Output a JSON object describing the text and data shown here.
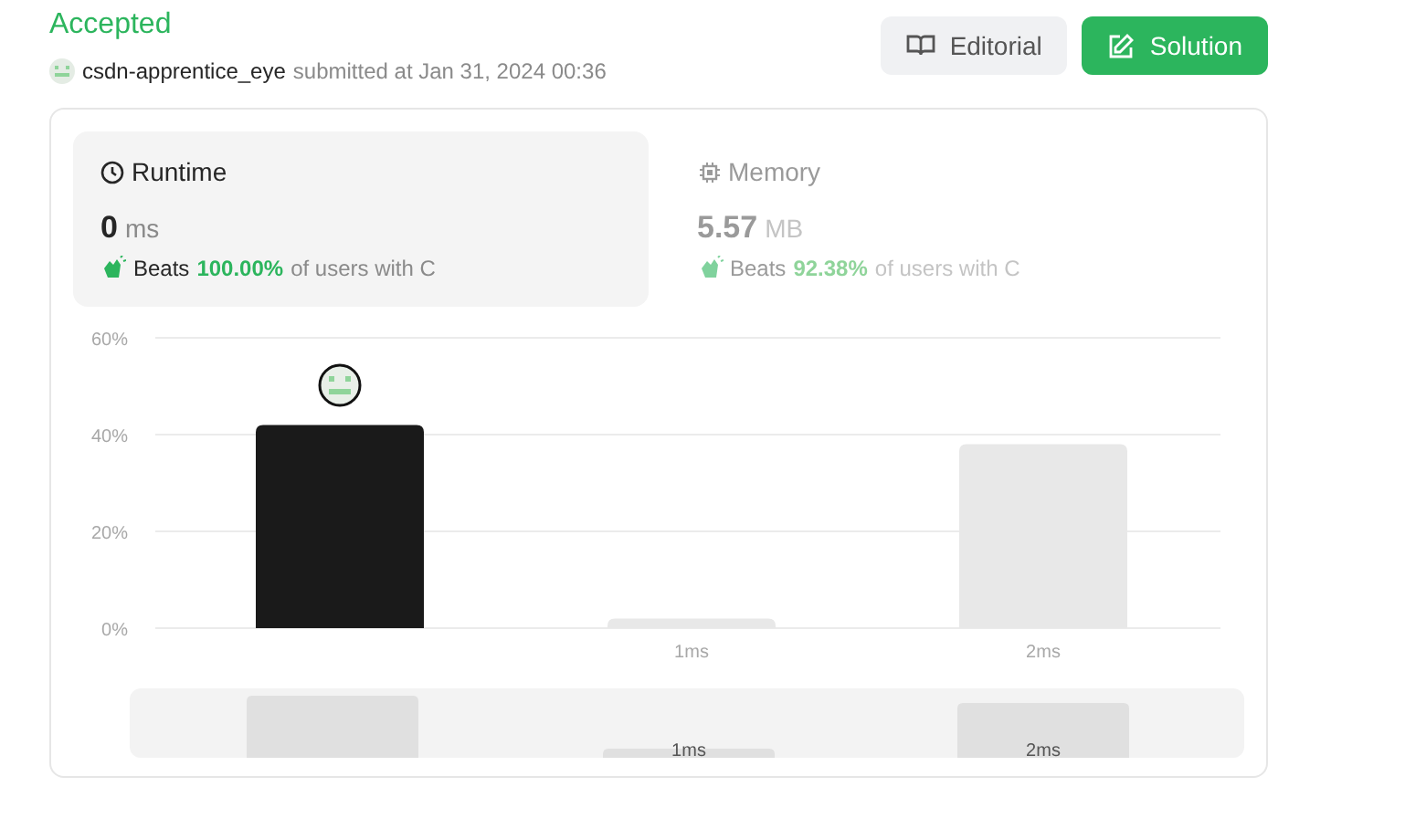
{
  "status": "Accepted",
  "submission": {
    "user": "csdn-apprentice_eye",
    "submitted": "submitted at Jan 31, 2024 00:36"
  },
  "buttons": [
    {
      "kind": "secondary",
      "label": "Editorial"
    },
    {
      "kind": "primary",
      "label": "Solution"
    }
  ],
  "metrics": [
    {
      "kind": "runtime",
      "title": "Runtime",
      "selected": true,
      "value": "0",
      "unit": "ms",
      "beats": "Beats",
      "percent": "100.00%",
      "suffix": "of users with C"
    },
    {
      "kind": "memory",
      "title": "Memory",
      "selected": false,
      "value": "5.57",
      "unit": "MB",
      "beats": "Beats",
      "percent": "92.38%",
      "suffix": "of users with C"
    }
  ],
  "chart_data": {
    "type": "bar",
    "categories": [
      null,
      "1ms",
      "2ms"
    ],
    "values": [
      42,
      2,
      38
    ],
    "ylim": [
      0,
      60
    ],
    "yticks": [
      {
        "value": 0,
        "label": "0%"
      },
      {
        "value": 20,
        "label": "20%"
      },
      {
        "value": 40,
        "label": "40%"
      },
      {
        "value": 60,
        "label": "60%"
      }
    ]
  },
  "navigator": {
    "labels": [
      "1ms",
      "2ms"
    ]
  }
}
